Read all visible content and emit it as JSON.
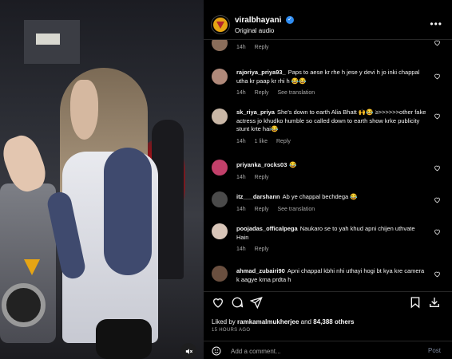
{
  "post": {
    "username": "viralbhayani",
    "verified": true,
    "subtitle": "Original audio",
    "more_label": "•••"
  },
  "comments": [
    {
      "username": "",
      "text": "",
      "time": "14h",
      "reply": "Reply",
      "likes": "",
      "translate": "",
      "avatar_color": "#8a6d5a"
    },
    {
      "username": "rajoriya_priya93_",
      "text": "Paps to aese kr rhe h jese y devi h jo inki chappal utha kr paap kr rhi h 😂😂",
      "time": "14h",
      "reply": "Reply",
      "likes": "",
      "translate": "See translation",
      "avatar_color": "#b0897a"
    },
    {
      "username": "sk_riya_priya",
      "text": "She's down to earth Alia Bhatt 🙌😂 ≥>>>>>>other fake actress jo khudko humble so called down to earth show krke publicity stunt krte hai😂",
      "time": "14h",
      "reply": "Reply",
      "likes": "1 like",
      "translate": "",
      "avatar_color": "#c9b7a6"
    },
    {
      "username": "priyanka_rocks03",
      "text": "😂",
      "time": "14h",
      "reply": "Reply",
      "likes": "",
      "translate": "",
      "avatar_color": "#c2406a"
    },
    {
      "username": "itz___darshann",
      "text": "Ab ye chappal bechdega 😂",
      "time": "14h",
      "reply": "Reply",
      "likes": "",
      "translate": "See translation",
      "avatar_color": "#4a4a4a"
    },
    {
      "username": "poojadas_officalpega",
      "text": "Naukaro se to yah khud apni chijen uthvate Hain",
      "time": "14h",
      "reply": "Reply",
      "likes": "",
      "translate": "",
      "avatar_color": "#d8c5b8"
    },
    {
      "username": "ahmad_zubairi90",
      "text": "Apni chappal kbhi nhi uthayi hogi bt kya kre camera k aagye krna prdta h",
      "time": "",
      "reply": "",
      "likes": "",
      "translate": "",
      "avatar_color": "#6a4f3f"
    }
  ],
  "actions": {
    "liked_by_prefix": "Liked by",
    "liked_by_user": "ramkamalmukherjee",
    "and_label": "and",
    "others": "84,388 others",
    "date": "15 HOURS AGO"
  },
  "add_comment": {
    "placeholder": "Add a comment...",
    "post_label": "Post"
  },
  "colors": {
    "panel_bg": "#000000",
    "text": "#f5f5f5",
    "muted": "#a8a8a8",
    "verified": "#2f8cf0",
    "brand": "#e6a514"
  }
}
